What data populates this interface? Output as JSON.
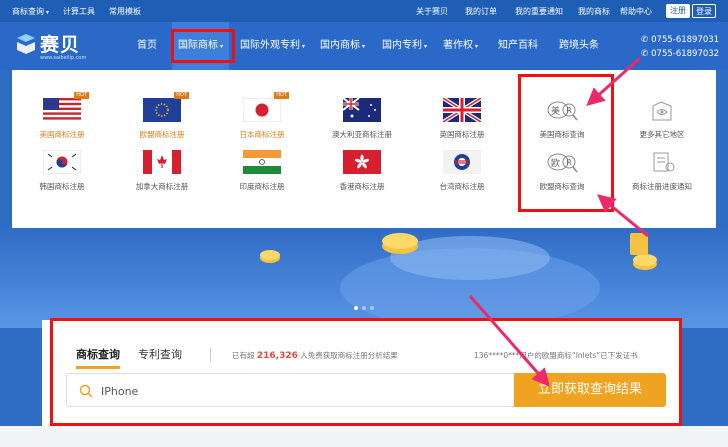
{
  "topbar": {
    "left_items": [
      {
        "label": "商标查询",
        "caret": "▾"
      },
      {
        "label": "计算工具"
      },
      {
        "label": "常用模板"
      }
    ],
    "right_items": [
      "关于赛贝",
      "我的订单",
      "我的重要通知",
      "我的商标",
      "帮助中心"
    ],
    "login": "注册",
    "register": "登录"
  },
  "header": {
    "logo_text": "赛贝",
    "logo_sub": "www.saibeilip.com",
    "nav": [
      {
        "label": "首页"
      },
      {
        "label": "国际商标",
        "caret": "▾",
        "active": true
      },
      {
        "label": "国际外观专利",
        "caret": "▾"
      },
      {
        "label": "国内商标",
        "caret": "▾"
      },
      {
        "label": "国内专利",
        "caret": "▾"
      },
      {
        "label": "著作权",
        "caret": "▾"
      },
      {
        "label": "知产百科"
      },
      {
        "label": "跨境头条"
      }
    ],
    "phones": [
      "0755-61897031",
      "0755-61897032"
    ]
  },
  "dropdown": {
    "row1": [
      {
        "label": "美国商标注册",
        "hot": "HOT",
        "flag": "usa-flag"
      },
      {
        "label": "欧盟商标注册",
        "hot": "HOT",
        "flag": "eu-flag"
      },
      {
        "label": "日本商标注册",
        "hot": "HOT",
        "flag": "japan-flag"
      },
      {
        "label": "澳大利亚商标注册",
        "flag": "australia-flag"
      },
      {
        "label": "英国商标注册",
        "flag": "uk-flag"
      },
      {
        "label": "美国商标查询",
        "flag": "us-search-icon",
        "glyph": "美"
      },
      {
        "label": "更多其它地区",
        "flag": "more-regions-icon"
      }
    ],
    "row2": [
      {
        "label": "韩国商标注册",
        "flag": "korea-flag"
      },
      {
        "label": "加拿大商标注册",
        "flag": "canada-flag"
      },
      {
        "label": "印度商标注册",
        "flag": "india-flag"
      },
      {
        "label": "香港商标注册",
        "flag": "hongkong-flag"
      },
      {
        "label": "台湾商标注册",
        "flag": "taiwan-flag"
      },
      {
        "label": "欧盟商标查询",
        "flag": "eu-search-icon",
        "glyph": "欧"
      },
      {
        "label": "商标注册进度通知",
        "flag": "progress-notice-icon"
      }
    ]
  },
  "search": {
    "tab_active": "商标查询",
    "tab_other": "专利查询",
    "stat_prefix": "已有超",
    "stat_count": "216,326",
    "stat_suffix": "人免费获取商标注册分析结果",
    "notice": "136****0***用户的欧盟商标“Inlets”已下发证书",
    "input_value": "IPhone",
    "submit": "立即获取查询结果"
  },
  "colors": {
    "brand_blue": "#2a69c7",
    "accent_orange": "#f0a321",
    "highlight_red": "#e11111"
  }
}
